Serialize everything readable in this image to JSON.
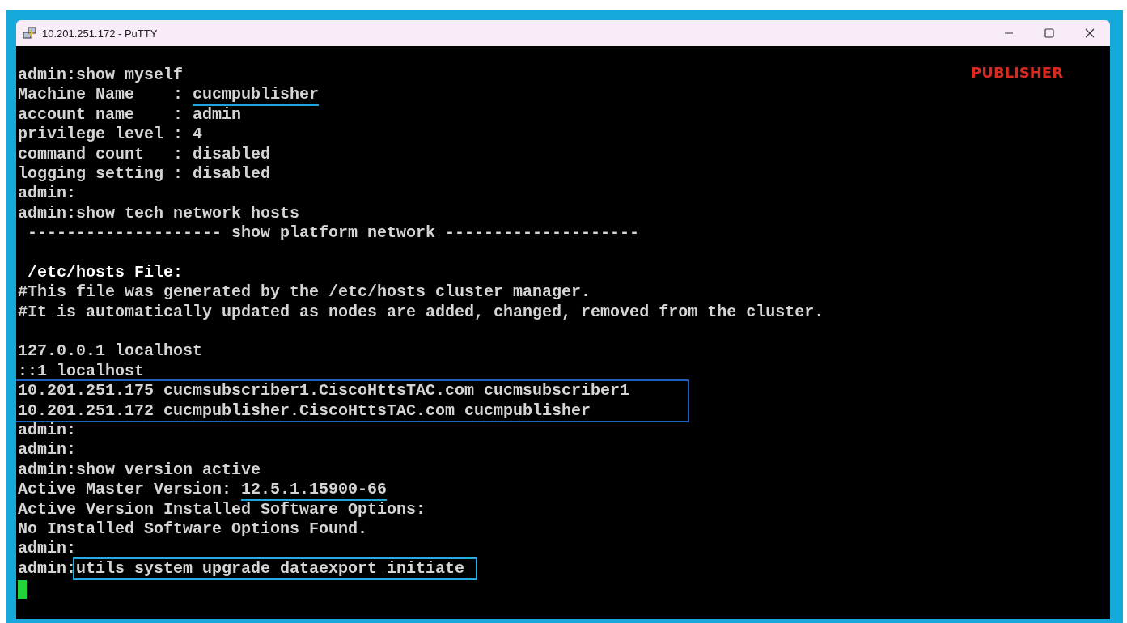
{
  "window": {
    "title": "10.201.251.172 - PuTTY"
  },
  "overlay_label": "PUBLISHER",
  "terminal": {
    "cursor_visible": true,
    "lines": [
      {
        "kind": "text",
        "text": "admin:show myself"
      },
      {
        "kind": "underlined",
        "prefix": "Machine Name    : ",
        "marked": "cucmpublisher"
      },
      {
        "kind": "text",
        "text": "account name    : admin"
      },
      {
        "kind": "text",
        "text": "privilege level : 4"
      },
      {
        "kind": "text",
        "text": "command count   : disabled"
      },
      {
        "kind": "text",
        "text": "logging setting : disabled"
      },
      {
        "kind": "text",
        "text": "admin:"
      },
      {
        "kind": "text",
        "text": "admin:show tech network hosts"
      },
      {
        "kind": "text",
        "text": " -------------------- show platform network --------------------"
      },
      {
        "kind": "blank"
      },
      {
        "kind": "text",
        "text": " /etc/hosts File:",
        "bold": true
      },
      {
        "kind": "text",
        "text": "#This file was generated by the /etc/hosts cluster manager."
      },
      {
        "kind": "text",
        "text": "#It is automatically updated as nodes are added, changed, removed from the cluster."
      },
      {
        "kind": "blank"
      },
      {
        "kind": "text",
        "text": "127.0.0.1 localhost"
      },
      {
        "kind": "text",
        "text": "::1 localhost"
      },
      {
        "kind": "boxed_group",
        "lines": [
          "10.201.251.175 cucmsubscriber1.CiscoHttsTAC.com cucmsubscriber1",
          "10.201.251.172 cucmpublisher.CiscoHttsTAC.com cucmpublisher"
        ]
      },
      {
        "kind": "text",
        "text": "admin:"
      },
      {
        "kind": "text",
        "text": "admin:"
      },
      {
        "kind": "text",
        "text": "admin:show version active"
      },
      {
        "kind": "underlined",
        "prefix": "Active Master Version: ",
        "marked": "12.5.1.15900-66"
      },
      {
        "kind": "text",
        "text": "Active Version Installed Software Options:"
      },
      {
        "kind": "text",
        "text": "No Installed Software Options Found."
      },
      {
        "kind": "text",
        "text": "admin:"
      },
      {
        "kind": "boxed_command",
        "prefix": "admin:",
        "marked": "utils system upgrade dataexport initiate"
      }
    ]
  }
}
